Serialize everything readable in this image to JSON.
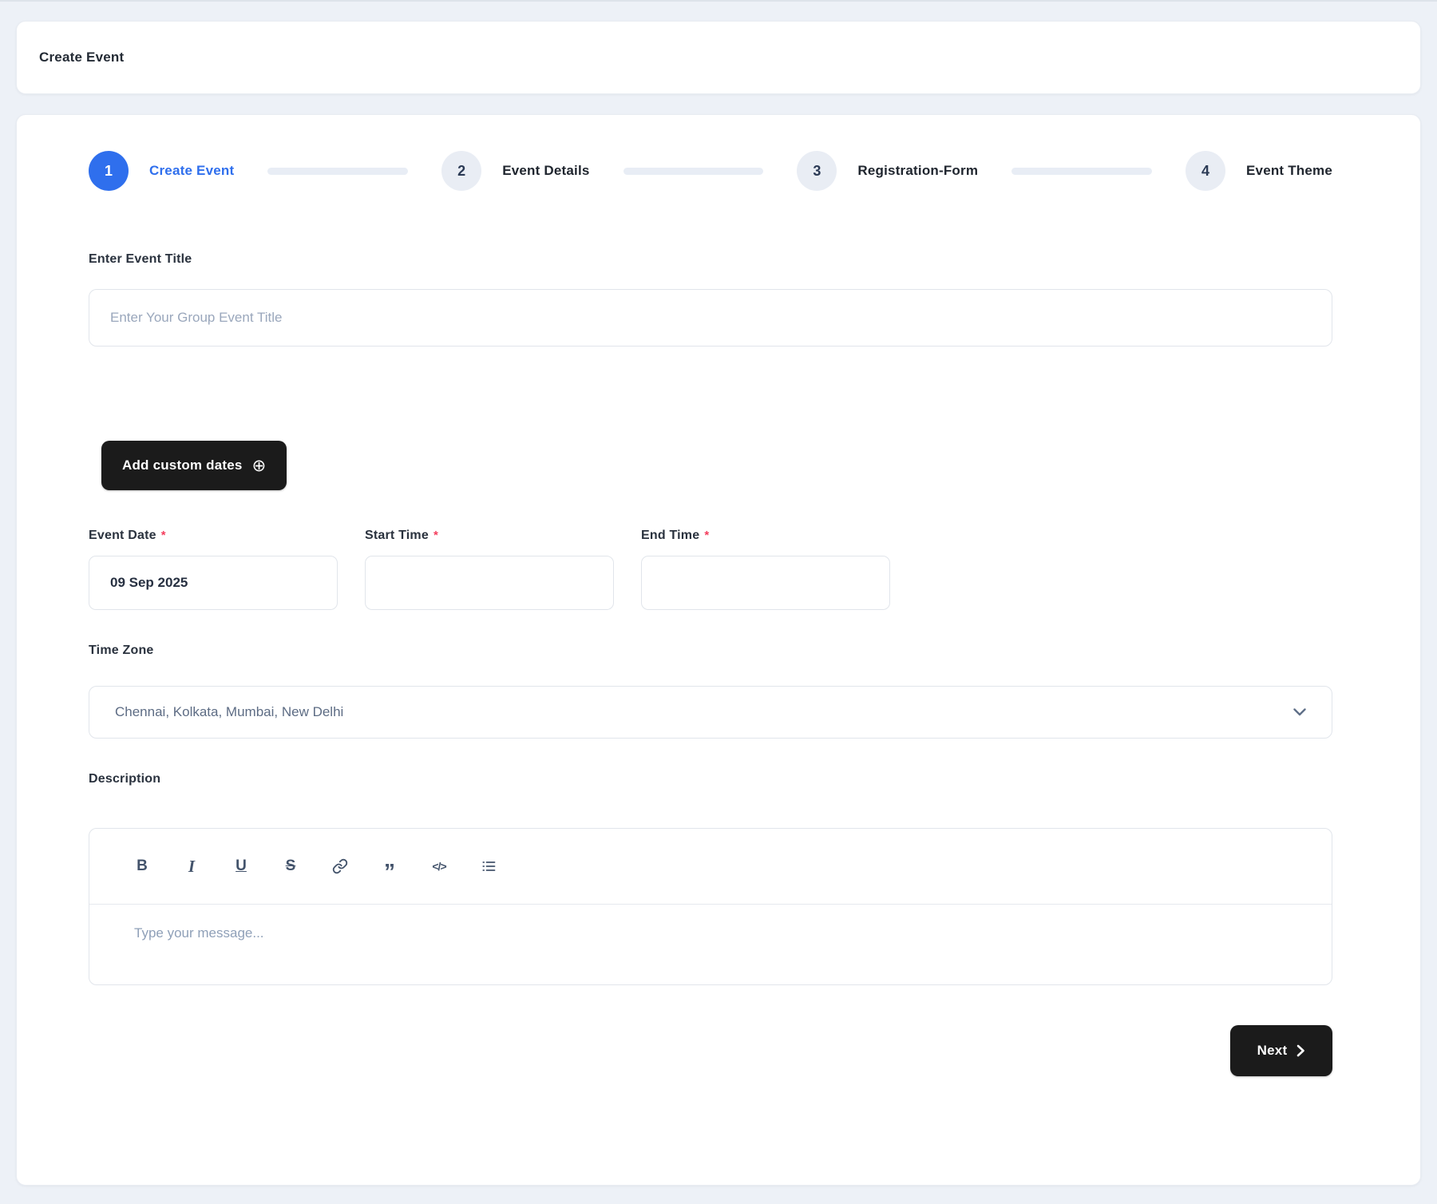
{
  "colors": {
    "accent_blue": "#2F6FED",
    "dark_button": "#1B1B1B",
    "required_red": "#F43F5E",
    "page_bg": "#EDF1F7"
  },
  "header": {
    "title": "Create Event"
  },
  "stepper": {
    "steps": [
      {
        "number": "1",
        "label": "Create Event",
        "state": "active"
      },
      {
        "number": "2",
        "label": "Event Details",
        "state": "inactive"
      },
      {
        "number": "3",
        "label": "Registration-Form",
        "state": "inactive"
      },
      {
        "number": "4",
        "label": "Event Theme",
        "state": "inactive"
      }
    ]
  },
  "form": {
    "required_marker": "*",
    "event_title": {
      "label": "Enter Event Title",
      "placeholder": "Enter Your Group Event Title",
      "value": ""
    },
    "add_custom_dates_button": {
      "label": "Add custom dates",
      "icon": "plus-circle-icon",
      "icon_glyph": "⊕"
    },
    "event_date": {
      "label": "Event Date",
      "value": "09 Sep 2025"
    },
    "start_time": {
      "label": "Start Time",
      "value": ""
    },
    "end_time": {
      "label": "End Time",
      "value": ""
    },
    "time_zone": {
      "label": "Time Zone",
      "value": "Chennai, Kolkata, Mumbai, New Delhi"
    },
    "description": {
      "label": "Description",
      "placeholder": "Type your message...",
      "toolbar": [
        {
          "name": "bold-icon",
          "glyph": "B"
        },
        {
          "name": "italic-icon",
          "glyph": "I"
        },
        {
          "name": "underline-icon",
          "glyph": "U"
        },
        {
          "name": "strikethrough-icon",
          "glyph": "S"
        },
        {
          "name": "link-icon",
          "glyph": ""
        },
        {
          "name": "quote-icon",
          "glyph": "”"
        },
        {
          "name": "code-icon",
          "glyph": "</>"
        },
        {
          "name": "list-icon",
          "glyph": ""
        }
      ]
    },
    "next_button": {
      "label": "Next"
    }
  }
}
